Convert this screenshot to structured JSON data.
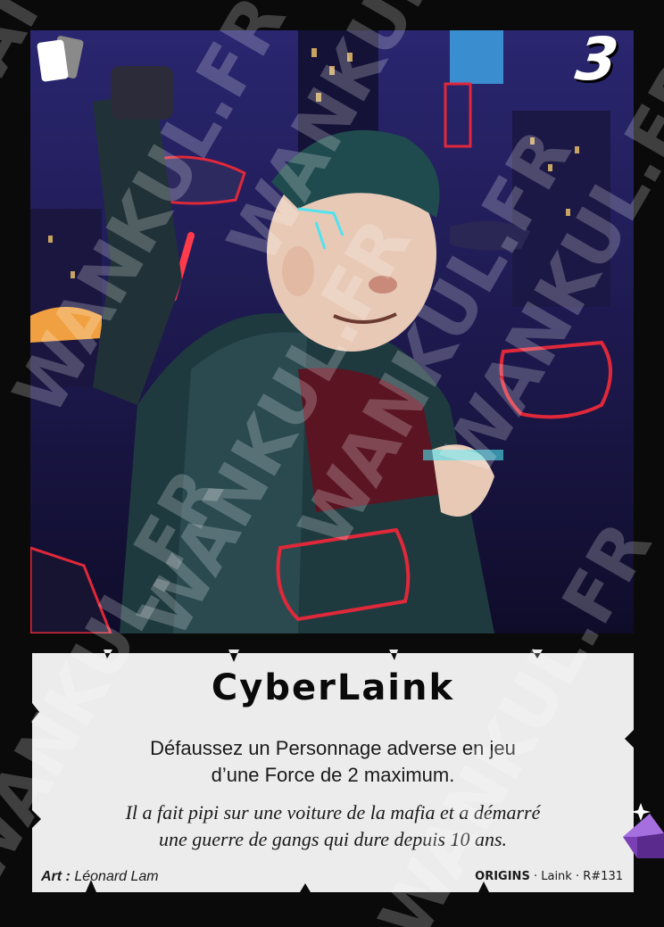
{
  "card": {
    "cost": "3",
    "name": "CyberLaink",
    "effect_line1": "Défaussez un Personnage adverse en jeu",
    "effect_line2": "d’une Force de 2 maximum.",
    "flavor_line1": "Il a fait pipi sur une voiture de la mafia et a démarré",
    "flavor_line2": "une guerre de gangs qui dure depuis 10 ans.",
    "art_label": "Art :",
    "artist": "Léonard Lam",
    "set_name": "ORIGINS",
    "character": "Laink",
    "collector_number": "R#131",
    "separator": "·",
    "watermark_text": "WANKUL.FR",
    "type_icon": "cards-icon",
    "rarity_icon": "purple-gem-icon",
    "colors": {
      "frame": "#0a0a0a",
      "textbox": "#ececec",
      "gem": "#7b3fb5",
      "art_bg": "#241f5c",
      "neon_red": "#e0283a",
      "neon_cyan": "#4fe3f0"
    }
  }
}
